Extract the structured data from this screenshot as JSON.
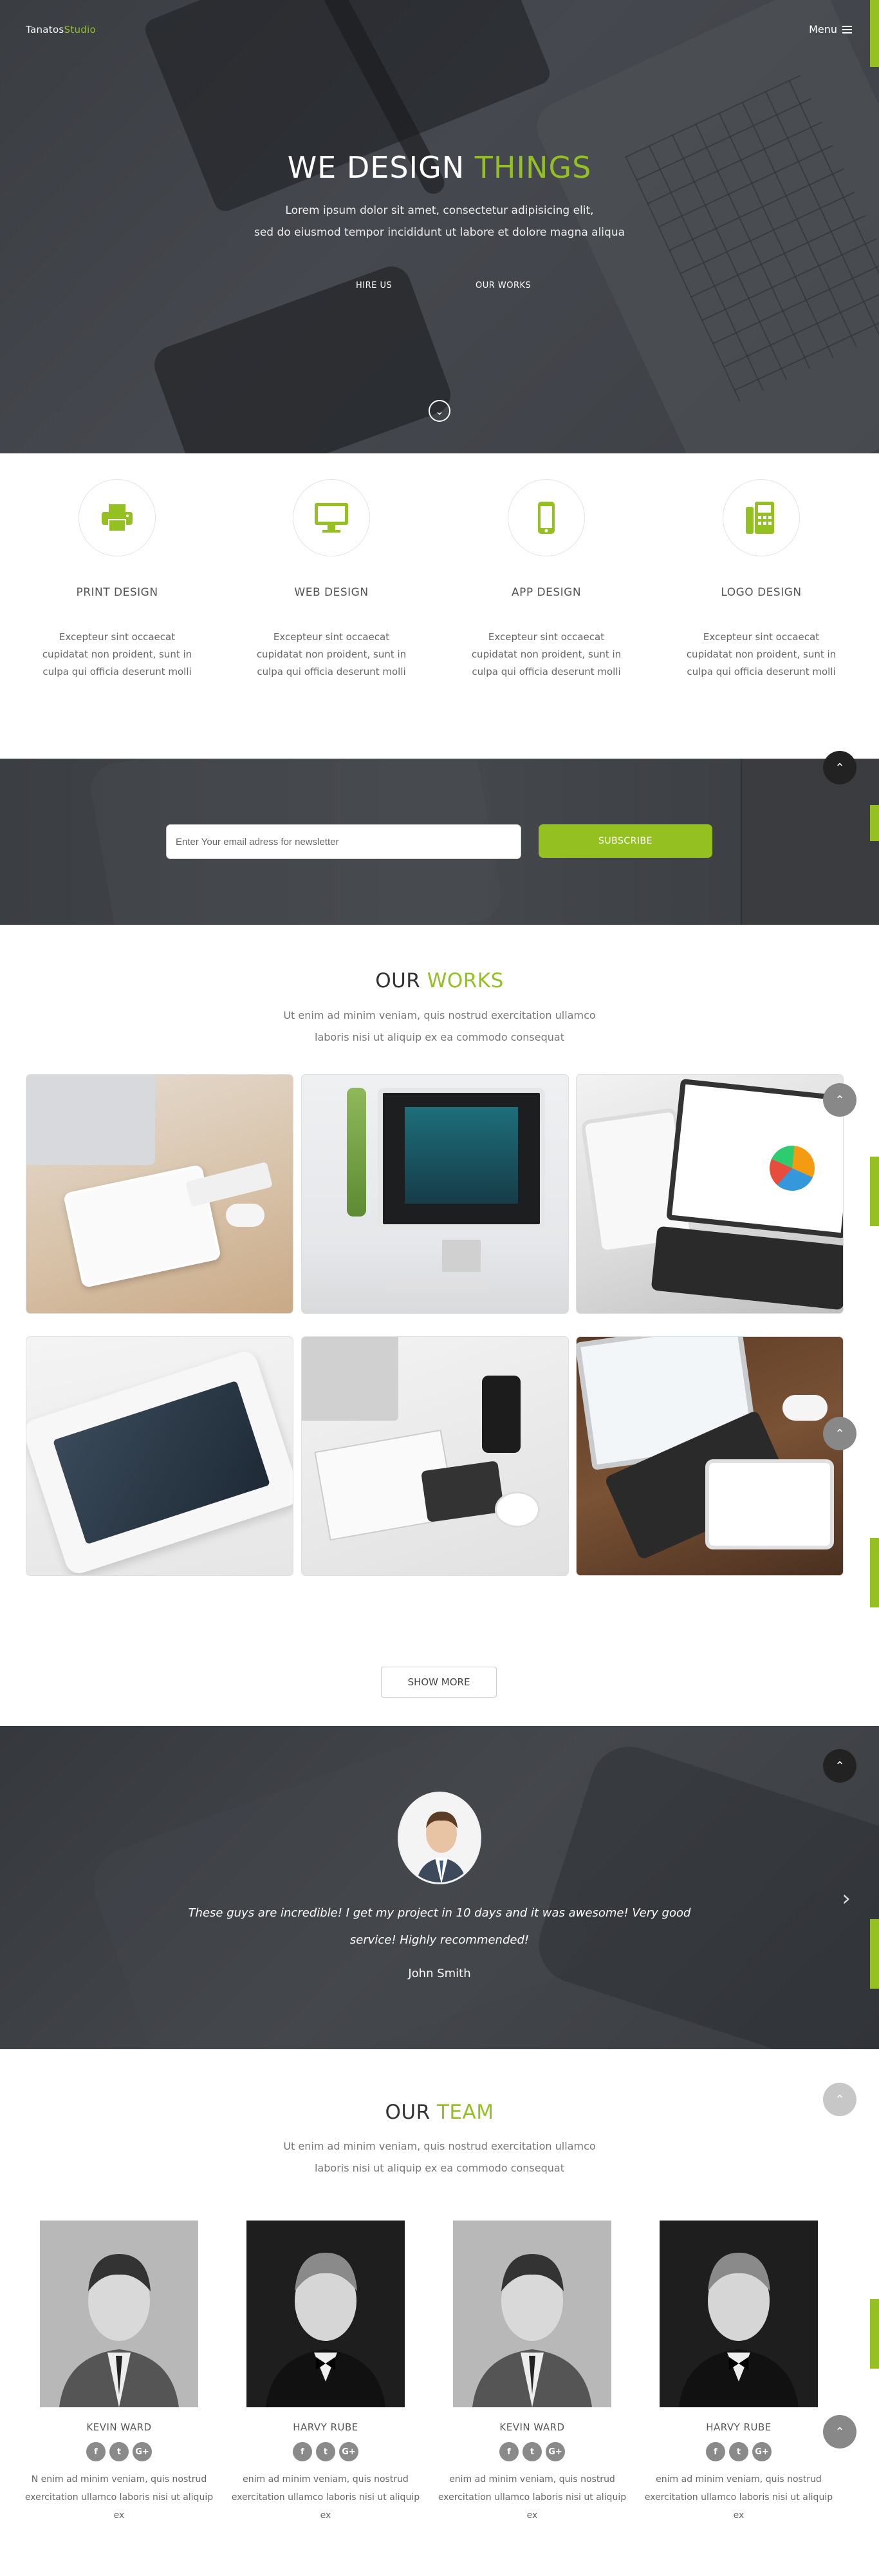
{
  "header": {
    "logo_main": "Tanatos",
    "logo_accent": "Studio",
    "menu_label": "Menu"
  },
  "hero": {
    "title_main": "WE DESIGN",
    "title_accent": "THINGS",
    "subtitle_line1": "Lorem ipsum dolor sit amet, consectetur adipisicing elit,",
    "subtitle_line2": "sed do eiusmod tempor incididunt ut labore et dolore magna aliqua",
    "btn_hire": "HIRE US",
    "btn_works": "OUR WORKS"
  },
  "services": [
    {
      "title": "PRINT DESIGN",
      "icon": "printer-icon",
      "text": "Excepteur sint occaecat cupidatat non proident, sunt in culpa qui officia deserunt molli"
    },
    {
      "title": "WEB DESIGN",
      "icon": "monitor-icon",
      "text": "Excepteur sint occaecat cupidatat non proident, sunt in culpa qui officia deserunt molli"
    },
    {
      "title": "APP DESIGN",
      "icon": "mobile-icon",
      "text": "Excepteur sint occaecat cupidatat non proident, sunt in culpa qui officia deserunt molli"
    },
    {
      "title": "LOGO DESIGN",
      "icon": "fax-icon",
      "text": "Excepteur sint occaecat cupidatat non proident, sunt in culpa qui officia deserunt molli"
    }
  ],
  "newsletter": {
    "placeholder": "Enter Your email adress for newsletter",
    "button": "SUBSCRIBE"
  },
  "works": {
    "title_main": "OUR",
    "title_accent": "WORKS",
    "subtitle_line1": "Ut enim ad minim veniam, quis nostrud exercitation ullamco",
    "subtitle_line2": "laboris nisi ut aliquip ex ea commodo consequat",
    "show_more": "SHOW MORE"
  },
  "testimonial": {
    "quote": "These guys are incredible! I get my project in 10 days and it was awesome! Very good service! Highly recommended!",
    "name": "John Smith"
  },
  "team": {
    "title_main": "OUR",
    "title_accent": "TEAM",
    "subtitle_line1": "Ut enim ad minim veniam, quis nostrud exercitation ullamco",
    "subtitle_line2": "laboris nisi ut aliquip ex ea commodo consequat",
    "members": [
      {
        "name": "KEVIN WARD",
        "text": "N enim ad minim veniam, quis nostrud exercitation ullamco laboris nisi ut aliquip ex"
      },
      {
        "name": "HARVY RUBE",
        "text": "enim ad minim veniam, quis nostrud exercitation ullamco laboris nisi ut aliquip ex"
      },
      {
        "name": "KEVIN WARD",
        "text": "enim ad minim veniam, quis nostrud exercitation ullamco laboris nisi ut aliquip ex"
      },
      {
        "name": "HARVY RUBE",
        "text": "enim ad minim veniam, quis nostrud exercitation ullamco laboris nisi ut aliquip ex"
      }
    ],
    "social": {
      "facebook": "f",
      "twitter": "t",
      "google": "G+"
    }
  },
  "colors": {
    "accent": "#94c121",
    "dark_bg": "#3f4247"
  }
}
